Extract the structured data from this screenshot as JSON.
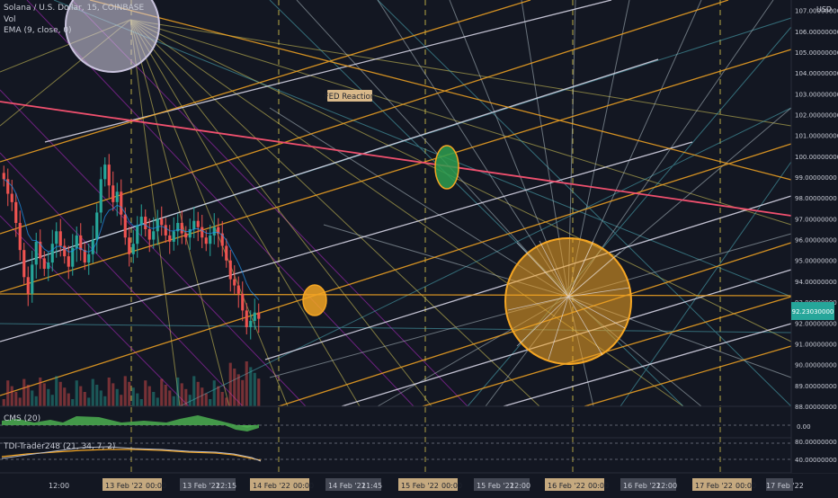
{
  "legend": {
    "symbol_line": "Solana / U.S. Dollar, 15, COINBASE",
    "vol_line": "Vol",
    "ema_line": "EMA (9, close, 0)"
  },
  "price_axis": {
    "currency": "USD",
    "current_price_label": "92.23030000",
    "colors": {
      "current": "#26a69a",
      "current_text": "#ffffff"
    }
  },
  "annotation": {
    "text": "FED Reaction"
  },
  "panes": {
    "cms": {
      "title": "CMS (20)",
      "tick": "0.00"
    },
    "tdi": {
      "title": "TDI-Trader248 (21, 34, 7, 2)",
      "ticks": [
        "80.00000000",
        "40.00000000"
      ]
    }
  },
  "time_axis": {
    "labels": [
      "12:00",
      "13 Feb '22",
      "00:00",
      "13 Feb '22",
      "12:15",
      "14 Feb '22",
      "00:00",
      "14 Feb '22",
      "11:45",
      "15 Feb '22",
      "00:00",
      "15 Feb '22",
      "12:00",
      "16 Feb '22",
      "00:00",
      "16 Feb '22",
      "12:00",
      "17 Feb '22",
      "00:00",
      "17 Feb '22"
    ]
  },
  "chart_data": {
    "type": "candlestick",
    "title": "Solana / U.S. Dollar, 15, COINBASE",
    "ylim": [
      88,
      107.5
    ],
    "y_ticks": [
      88,
      89,
      90,
      91,
      92,
      93,
      94,
      95,
      96,
      97,
      98,
      99,
      100,
      101,
      102,
      103,
      104,
      105,
      106,
      107
    ],
    "y_tick_labels": [
      "88.00000000",
      "89.00000000",
      "90.00000000",
      "91.00000000",
      "92.00000000",
      "93.00000000",
      "94.00000000",
      "95.00000000",
      "96.00000000",
      "97.00000000",
      "98.00000000",
      "99.00000000",
      "100.00000000",
      "101.00000000",
      "102.00000000",
      "103.00000000",
      "104.00000000",
      "105.00000000",
      "106.00000000",
      "107.00000000"
    ],
    "x_labels": [
      "12:00",
      "13 Feb '22 00:00",
      "13 Feb '22 12:15",
      "14 Feb '22 00:00",
      "14 Feb '22 11:45",
      "15 Feb '22 00:00",
      "15 Feb '22 12:00",
      "16 Feb '22 00:00",
      "16 Feb '22 12:00",
      "17 Feb '22 00:00",
      "17 Feb '22"
    ],
    "close_series": [
      98.9,
      98.2,
      97.8,
      96.8,
      95.5,
      94.2,
      93.4,
      94.8,
      95.9,
      95.1,
      94.6,
      94.9,
      95.8,
      96.4,
      95.7,
      95.2,
      94.7,
      95.6,
      96.2,
      95.5,
      94.9,
      95.3,
      96.0,
      97.3,
      98.9,
      99.6,
      98.6,
      97.8,
      98.3,
      97.2,
      96.1,
      95.3,
      95.8,
      96.7,
      97.1,
      96.5,
      96.0,
      96.4,
      97.0,
      96.7,
      96.2,
      95.9,
      96.4,
      96.8,
      96.3,
      96.1,
      96.5,
      96.9,
      96.6,
      96.1,
      95.8,
      96.2,
      96.6,
      96.3,
      95.7,
      95.0,
      94.1,
      93.8,
      93.4,
      92.6,
      91.8,
      92.1,
      92.5,
      92.2
    ],
    "colors": {
      "up": "#26a69a",
      "down": "#ef5350"
    },
    "annotations": [
      "FED Reaction"
    ]
  }
}
